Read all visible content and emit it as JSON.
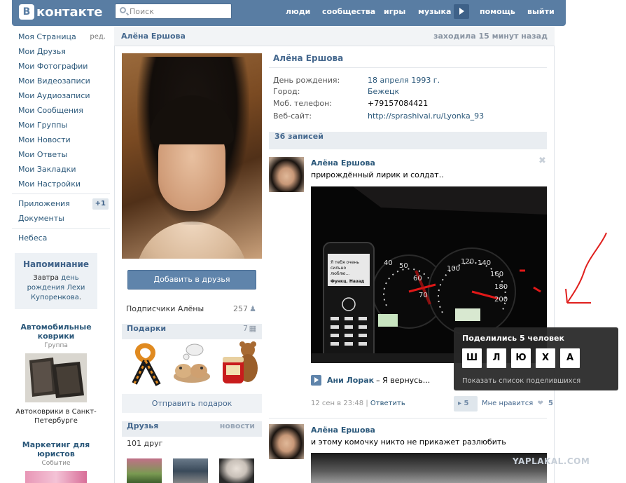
{
  "header": {
    "logo_word": "контакте",
    "search_placeholder": "Поиск",
    "nav": [
      "люди",
      "сообщества",
      "игры",
      "музыка",
      "помощь",
      "выйти"
    ]
  },
  "sidebar": {
    "items": [
      {
        "label": "Моя Страница",
        "aux": "ред."
      },
      {
        "label": "Мои Друзья"
      },
      {
        "label": "Мои Фотографии"
      },
      {
        "label": "Мои Видеозаписи"
      },
      {
        "label": "Мои Аудиозаписи"
      },
      {
        "label": "Мои Сообщения"
      },
      {
        "label": "Мои Группы"
      },
      {
        "label": "Мои Новости"
      },
      {
        "label": "Мои Ответы"
      },
      {
        "label": "Мои Закладки"
      },
      {
        "label": "Мои Настройки"
      }
    ],
    "apps_label": "Приложения",
    "apps_badge": "+1",
    "docs_label": "Документы",
    "sky_label": "Небеса"
  },
  "reminder": {
    "title": "Напоминание",
    "text_before": "Завтра",
    "text_link": "день рождения",
    "text_name": "Лехи Купоренкова",
    "text_after": "."
  },
  "ads": [
    {
      "title": "Автомобильные коврики",
      "sub": "Группа",
      "text": "Автоковрики в Санкт-Петербурге"
    },
    {
      "title": "Маркетинг для юристов",
      "sub": "Событие"
    }
  ],
  "page": {
    "name": "Алёна Ершова",
    "last_seen": "заходила 15 минут назад"
  },
  "profile": {
    "name": "Алёна Ершова",
    "add_friend": "Добавить в друзья",
    "followers_label": "Подписчики Алёны",
    "followers_count": "257",
    "gifts_label": "Подарки",
    "gifts_count": "7",
    "send_gift": "Отправить подарок",
    "friends_label": "Друзья",
    "friends_link": "новости",
    "friends_count": "101 друг",
    "info": [
      {
        "key": "День рождения:",
        "value": "18 апреля 1993 г."
      },
      {
        "key": "Город:",
        "value": "Бежецк"
      },
      {
        "key": "Моб. телефон:",
        "value": "+79157084421"
      },
      {
        "key": "Веб-сайт:",
        "value": "http://sprashivai.ru/Lyonka_93"
      }
    ]
  },
  "wall": {
    "count_label": "36 записей",
    "post1": {
      "author": "Алёна Ершова",
      "text": "прирождённый лирик и солдат..",
      "phone_screen_text": "Я тебя очень сильно люблю... Функц. Назад",
      "audio_artist": "Ани Лорак",
      "audio_title": "– Я вернусь...",
      "date": "12 сен в 23:48",
      "reply": "Ответить",
      "shares": "5",
      "like_label": "Мне нравится",
      "likes": "5"
    },
    "post2": {
      "author": "Алёна Ершова",
      "text": "и этому комочку никто не прикажет разлюбить"
    }
  },
  "tooltip": {
    "title": "Поделились 5 человек",
    "letters": [
      "Ш",
      "Л",
      "Ю",
      "Х",
      "А"
    ],
    "link": "Показать список поделившихся"
  },
  "watermark": "YAPLAKAL.COM",
  "colors": {
    "header_bg": "#597da3",
    "link": "#2b587a",
    "section_bg": "#e9edf1",
    "annotation_red": "#e0201e"
  },
  "icons": [
    "search-icon",
    "play-icon",
    "people-icon",
    "gift-icon",
    "close-icon",
    "megaphone-icon",
    "heart-icon"
  ]
}
